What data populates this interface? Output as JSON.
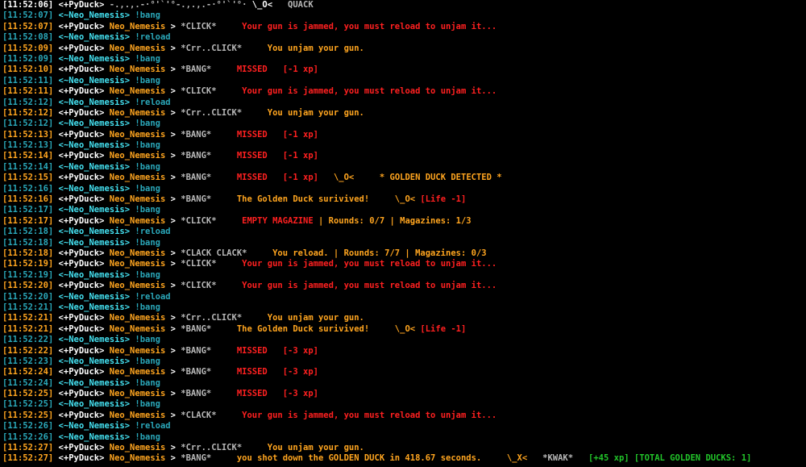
{
  "colors": {
    "background": "#000000",
    "gray": "#b8b8b8",
    "white": "#ffffff",
    "orange": "#ffa51f",
    "teal": "#2aa7b9",
    "cyan": "#44e0f0",
    "red": "#ff2020",
    "green": "#22c52a"
  },
  "lines": [
    {
      "kind": "message",
      "segments": [
        {
          "text": "[11:52:06] ",
          "color": "white"
        },
        {
          "text": "<+PyDuck> ",
          "color": "white"
        },
        {
          "text": "-.,.,.-·°'`'°-.,.,.-·°'`'°· ",
          "color": "gray"
        },
        {
          "text": "\\_O<",
          "color": "white"
        },
        {
          "text": "   QUACK",
          "color": "gray"
        }
      ]
    },
    {
      "kind": "message",
      "segments": [
        {
          "text": "[11:52:07] ",
          "color": "teal"
        },
        {
          "text": "<~Neo_Nemesis> ",
          "color": "cyan"
        },
        {
          "text": "!bang",
          "color": "teal"
        }
      ]
    },
    {
      "kind": "message",
      "segments": [
        {
          "text": "[11:52:07] ",
          "color": "orange"
        },
        {
          "text": "<+PyDuck> ",
          "color": "white"
        },
        {
          "text": "Neo_Nemesis",
          "color": "orange"
        },
        {
          "text": " > ",
          "color": "white"
        },
        {
          "text": "*CLICK*",
          "color": "gray"
        },
        {
          "text": "     Your gun is jammed, you must reload to unjam it...",
          "color": "red"
        }
      ]
    },
    {
      "kind": "message",
      "segments": [
        {
          "text": "[11:52:08] ",
          "color": "teal"
        },
        {
          "text": "<~Neo_Nemesis> ",
          "color": "cyan"
        },
        {
          "text": "!reload",
          "color": "teal"
        }
      ]
    },
    {
      "kind": "message",
      "segments": [
        {
          "text": "[11:52:09] ",
          "color": "orange"
        },
        {
          "text": "<+PyDuck> ",
          "color": "white"
        },
        {
          "text": "Neo_Nemesis",
          "color": "orange"
        },
        {
          "text": " > ",
          "color": "white"
        },
        {
          "text": "*Crr..CLICK*",
          "color": "gray"
        },
        {
          "text": "     You unjam your gun.",
          "color": "orange"
        }
      ]
    },
    {
      "kind": "message",
      "segments": [
        {
          "text": "[11:52:09] ",
          "color": "teal"
        },
        {
          "text": "<~Neo_Nemesis> ",
          "color": "cyan"
        },
        {
          "text": "!bang",
          "color": "teal"
        }
      ]
    },
    {
      "kind": "message",
      "segments": [
        {
          "text": "[11:52:10] ",
          "color": "orange"
        },
        {
          "text": "<+PyDuck> ",
          "color": "white"
        },
        {
          "text": "Neo_Nemesis",
          "color": "orange"
        },
        {
          "text": " > ",
          "color": "white"
        },
        {
          "text": "*BANG*",
          "color": "gray"
        },
        {
          "text": "     MISSED   [-1 xp]",
          "color": "red"
        }
      ]
    },
    {
      "kind": "message",
      "segments": [
        {
          "text": "[11:52:11] ",
          "color": "teal"
        },
        {
          "text": "<~Neo_Nemesis> ",
          "color": "cyan"
        },
        {
          "text": "!bang",
          "color": "teal"
        }
      ]
    },
    {
      "kind": "message",
      "segments": [
        {
          "text": "[11:52:11] ",
          "color": "orange"
        },
        {
          "text": "<+PyDuck> ",
          "color": "white"
        },
        {
          "text": "Neo_Nemesis",
          "color": "orange"
        },
        {
          "text": " > ",
          "color": "white"
        },
        {
          "text": "*CLICK*",
          "color": "gray"
        },
        {
          "text": "     Your gun is jammed, you must reload to unjam it...",
          "color": "red"
        }
      ]
    },
    {
      "kind": "message",
      "segments": [
        {
          "text": "[11:52:12] ",
          "color": "teal"
        },
        {
          "text": "<~Neo_Nemesis> ",
          "color": "cyan"
        },
        {
          "text": "!reload",
          "color": "teal"
        }
      ]
    },
    {
      "kind": "message",
      "segments": [
        {
          "text": "[11:52:12] ",
          "color": "orange"
        },
        {
          "text": "<+PyDuck> ",
          "color": "white"
        },
        {
          "text": "Neo_Nemesis",
          "color": "orange"
        },
        {
          "text": " > ",
          "color": "white"
        },
        {
          "text": "*Crr..CLICK*",
          "color": "gray"
        },
        {
          "text": "     You unjam your gun.",
          "color": "orange"
        }
      ]
    },
    {
      "kind": "message",
      "segments": [
        {
          "text": "[11:52:12] ",
          "color": "teal"
        },
        {
          "text": "<~Neo_Nemesis> ",
          "color": "cyan"
        },
        {
          "text": "!bang",
          "color": "teal"
        }
      ]
    },
    {
      "kind": "message",
      "segments": [
        {
          "text": "[11:52:13] ",
          "color": "orange"
        },
        {
          "text": "<+PyDuck> ",
          "color": "white"
        },
        {
          "text": "Neo_Nemesis",
          "color": "orange"
        },
        {
          "text": " > ",
          "color": "white"
        },
        {
          "text": "*BANG*",
          "color": "gray"
        },
        {
          "text": "     MISSED   [-1 xp]",
          "color": "red"
        }
      ]
    },
    {
      "kind": "message",
      "segments": [
        {
          "text": "[11:52:13] ",
          "color": "teal"
        },
        {
          "text": "<~Neo_Nemesis> ",
          "color": "cyan"
        },
        {
          "text": "!bang",
          "color": "teal"
        }
      ]
    },
    {
      "kind": "message",
      "segments": [
        {
          "text": "[11:52:14] ",
          "color": "orange"
        },
        {
          "text": "<+PyDuck> ",
          "color": "white"
        },
        {
          "text": "Neo_Nemesis",
          "color": "orange"
        },
        {
          "text": " > ",
          "color": "white"
        },
        {
          "text": "*BANG*",
          "color": "gray"
        },
        {
          "text": "     MISSED   [-1 xp]",
          "color": "red"
        }
      ]
    },
    {
      "kind": "message",
      "segments": [
        {
          "text": "[11:52:14] ",
          "color": "teal"
        },
        {
          "text": "<~Neo_Nemesis> ",
          "color": "cyan"
        },
        {
          "text": "!bang",
          "color": "teal"
        }
      ]
    },
    {
      "kind": "message",
      "segments": [
        {
          "text": "[11:52:15] ",
          "color": "orange"
        },
        {
          "text": "<+PyDuck> ",
          "color": "white"
        },
        {
          "text": "Neo_Nemesis",
          "color": "orange"
        },
        {
          "text": " > ",
          "color": "white"
        },
        {
          "text": "*BANG*",
          "color": "gray"
        },
        {
          "text": "     MISSED   [-1 xp]",
          "color": "red"
        },
        {
          "text": "   \\_O<",
          "color": "orange"
        },
        {
          "text": "     * GOLDEN DUCK DETECTED *",
          "color": "orange"
        }
      ]
    },
    {
      "kind": "message",
      "segments": [
        {
          "text": "[11:52:16] ",
          "color": "teal"
        },
        {
          "text": "<~Neo_Nemesis> ",
          "color": "cyan"
        },
        {
          "text": "!bang",
          "color": "teal"
        }
      ]
    },
    {
      "kind": "message",
      "segments": [
        {
          "text": "[11:52:16] ",
          "color": "orange"
        },
        {
          "text": "<+PyDuck> ",
          "color": "white"
        },
        {
          "text": "Neo_Nemesis",
          "color": "orange"
        },
        {
          "text": " > ",
          "color": "white"
        },
        {
          "text": "*BANG*",
          "color": "gray"
        },
        {
          "text": "     The Golden Duck surivived!",
          "color": "orange"
        },
        {
          "text": "     \\_O< ",
          "color": "orange"
        },
        {
          "text": "[Life -1]",
          "color": "red"
        }
      ]
    },
    {
      "kind": "message",
      "segments": [
        {
          "text": "[11:52:17] ",
          "color": "teal"
        },
        {
          "text": "<~Neo_Nemesis> ",
          "color": "cyan"
        },
        {
          "text": "!bang",
          "color": "teal"
        }
      ]
    },
    {
      "kind": "message",
      "segments": [
        {
          "text": "[11:52:17] ",
          "color": "orange"
        },
        {
          "text": "<+PyDuck> ",
          "color": "white"
        },
        {
          "text": "Neo_Nemesis",
          "color": "orange"
        },
        {
          "text": " > ",
          "color": "white"
        },
        {
          "text": "*CLICK*",
          "color": "gray"
        },
        {
          "text": "     EMPTY MAGAZINE",
          "color": "red"
        },
        {
          "text": " | Rounds: 0/7 | Magazines: 1/3",
          "color": "orange"
        }
      ]
    },
    {
      "kind": "message",
      "segments": [
        {
          "text": "[11:52:18] ",
          "color": "teal"
        },
        {
          "text": "<~Neo_Nemesis> ",
          "color": "cyan"
        },
        {
          "text": "!reload",
          "color": "teal"
        }
      ]
    },
    {
      "kind": "message",
      "segments": [
        {
          "text": "[11:52:18] ",
          "color": "teal"
        },
        {
          "text": "<~Neo_Nemesis> ",
          "color": "cyan"
        },
        {
          "text": "!bang",
          "color": "teal"
        }
      ]
    },
    {
      "kind": "message",
      "segments": [
        {
          "text": "[11:52:18] ",
          "color": "orange"
        },
        {
          "text": "<+PyDuck> ",
          "color": "white"
        },
        {
          "text": "Neo_Nemesis",
          "color": "orange"
        },
        {
          "text": " > ",
          "color": "white"
        },
        {
          "text": "*CLACK CLACK*",
          "color": "gray"
        },
        {
          "text": "     You reload. | Rounds: 7/7 | Magazines: 0/3",
          "color": "orange"
        }
      ]
    },
    {
      "kind": "message",
      "segments": [
        {
          "text": "[11:52:19] ",
          "color": "orange"
        },
        {
          "text": "<+PyDuck> ",
          "color": "white"
        },
        {
          "text": "Neo_Nemesis",
          "color": "orange"
        },
        {
          "text": " > ",
          "color": "white"
        },
        {
          "text": "*CLICK*",
          "color": "gray"
        },
        {
          "text": "     Your gun is jammed, you must reload to unjam it...",
          "color": "red"
        }
      ]
    },
    {
      "kind": "message",
      "segments": [
        {
          "text": "[11:52:19] ",
          "color": "teal"
        },
        {
          "text": "<~Neo_Nemesis> ",
          "color": "cyan"
        },
        {
          "text": "!bang",
          "color": "teal"
        }
      ]
    },
    {
      "kind": "message",
      "segments": [
        {
          "text": "[11:52:20] ",
          "color": "orange"
        },
        {
          "text": "<+PyDuck> ",
          "color": "white"
        },
        {
          "text": "Neo_Nemesis",
          "color": "orange"
        },
        {
          "text": " > ",
          "color": "white"
        },
        {
          "text": "*CLICK*",
          "color": "gray"
        },
        {
          "text": "     Your gun is jammed, you must reload to unjam it...",
          "color": "red"
        }
      ]
    },
    {
      "kind": "message",
      "segments": [
        {
          "text": "[11:52:20] ",
          "color": "teal"
        },
        {
          "text": "<~Neo_Nemesis> ",
          "color": "cyan"
        },
        {
          "text": "!reload",
          "color": "teal"
        }
      ]
    },
    {
      "kind": "message",
      "segments": [
        {
          "text": "[11:52:21] ",
          "color": "teal"
        },
        {
          "text": "<~Neo_Nemesis> ",
          "color": "cyan"
        },
        {
          "text": "!bang",
          "color": "teal"
        }
      ]
    },
    {
      "kind": "message",
      "segments": [
        {
          "text": "[11:52:21] ",
          "color": "orange"
        },
        {
          "text": "<+PyDuck> ",
          "color": "white"
        },
        {
          "text": "Neo_Nemesis",
          "color": "orange"
        },
        {
          "text": " > ",
          "color": "white"
        },
        {
          "text": "*Crr..CLICK*",
          "color": "gray"
        },
        {
          "text": "     You unjam your gun.",
          "color": "orange"
        }
      ]
    },
    {
      "kind": "message",
      "segments": [
        {
          "text": "[11:52:21] ",
          "color": "orange"
        },
        {
          "text": "<+PyDuck> ",
          "color": "white"
        },
        {
          "text": "Neo_Nemesis",
          "color": "orange"
        },
        {
          "text": " > ",
          "color": "white"
        },
        {
          "text": "*BANG*",
          "color": "gray"
        },
        {
          "text": "     The Golden Duck surivived!",
          "color": "orange"
        },
        {
          "text": "     \\_O< ",
          "color": "orange"
        },
        {
          "text": "[Life -1]",
          "color": "red"
        }
      ]
    },
    {
      "kind": "message",
      "segments": [
        {
          "text": "[11:52:22] ",
          "color": "teal"
        },
        {
          "text": "<~Neo_Nemesis> ",
          "color": "cyan"
        },
        {
          "text": "!bang",
          "color": "teal"
        }
      ]
    },
    {
      "kind": "message",
      "segments": [
        {
          "text": "[11:52:22] ",
          "color": "orange"
        },
        {
          "text": "<+PyDuck> ",
          "color": "white"
        },
        {
          "text": "Neo_Nemesis",
          "color": "orange"
        },
        {
          "text": " > ",
          "color": "white"
        },
        {
          "text": "*BANG*",
          "color": "gray"
        },
        {
          "text": "     MISSED   [-3 xp]",
          "color": "red"
        }
      ]
    },
    {
      "kind": "message",
      "segments": [
        {
          "text": "[11:52:23] ",
          "color": "teal"
        },
        {
          "text": "<~Neo_Nemesis> ",
          "color": "cyan"
        },
        {
          "text": "!bang",
          "color": "teal"
        }
      ]
    },
    {
      "kind": "message",
      "segments": [
        {
          "text": "[11:52:24] ",
          "color": "orange"
        },
        {
          "text": "<+PyDuck> ",
          "color": "white"
        },
        {
          "text": "Neo_Nemesis",
          "color": "orange"
        },
        {
          "text": " > ",
          "color": "white"
        },
        {
          "text": "*BANG*",
          "color": "gray"
        },
        {
          "text": "     MISSED   [-3 xp]",
          "color": "red"
        }
      ]
    },
    {
      "kind": "message",
      "segments": [
        {
          "text": "[11:52:24] ",
          "color": "teal"
        },
        {
          "text": "<~Neo_Nemesis> ",
          "color": "cyan"
        },
        {
          "text": "!bang",
          "color": "teal"
        }
      ]
    },
    {
      "kind": "message",
      "segments": [
        {
          "text": "[11:52:25] ",
          "color": "orange"
        },
        {
          "text": "<+PyDuck> ",
          "color": "white"
        },
        {
          "text": "Neo_Nemesis",
          "color": "orange"
        },
        {
          "text": " > ",
          "color": "white"
        },
        {
          "text": "*BANG*",
          "color": "gray"
        },
        {
          "text": "     MISSED   [-3 xp]",
          "color": "red"
        }
      ]
    },
    {
      "kind": "message",
      "segments": [
        {
          "text": "[11:52:25] ",
          "color": "teal"
        },
        {
          "text": "<~Neo_Nemesis> ",
          "color": "cyan"
        },
        {
          "text": "!bang",
          "color": "teal"
        }
      ]
    },
    {
      "kind": "message",
      "segments": [
        {
          "text": "[11:52:25] ",
          "color": "orange"
        },
        {
          "text": "<+PyDuck> ",
          "color": "white"
        },
        {
          "text": "Neo_Nemesis",
          "color": "orange"
        },
        {
          "text": " > ",
          "color": "white"
        },
        {
          "text": "*CLACK*",
          "color": "gray"
        },
        {
          "text": "     Your gun is jammed, you must reload to unjam it...",
          "color": "red"
        }
      ]
    },
    {
      "kind": "message",
      "segments": [
        {
          "text": "[11:52:26] ",
          "color": "teal"
        },
        {
          "text": "<~Neo_Nemesis> ",
          "color": "cyan"
        },
        {
          "text": "!reload",
          "color": "teal"
        }
      ]
    },
    {
      "kind": "message",
      "segments": [
        {
          "text": "[11:52:26] ",
          "color": "teal"
        },
        {
          "text": "<~Neo_Nemesis> ",
          "color": "cyan"
        },
        {
          "text": "!bang",
          "color": "teal"
        }
      ]
    },
    {
      "kind": "message",
      "segments": [
        {
          "text": "[11:52:27] ",
          "color": "orange"
        },
        {
          "text": "<+PyDuck> ",
          "color": "white"
        },
        {
          "text": "Neo_Nemesis",
          "color": "orange"
        },
        {
          "text": " > ",
          "color": "white"
        },
        {
          "text": "*Crr..CLICK*",
          "color": "gray"
        },
        {
          "text": "     You unjam your gun.",
          "color": "orange"
        }
      ]
    },
    {
      "kind": "message",
      "segments": [
        {
          "text": "[11:52:27] ",
          "color": "orange"
        },
        {
          "text": "<+PyDuck> ",
          "color": "white"
        },
        {
          "text": "Neo_Nemesis",
          "color": "orange"
        },
        {
          "text": " > ",
          "color": "white"
        },
        {
          "text": "*BANG*",
          "color": "gray"
        },
        {
          "text": "     you shot down the GOLDEN DUCK in 418.67 seconds.",
          "color": "orange"
        },
        {
          "text": "     \\_X<",
          "color": "orange"
        },
        {
          "text": "   *KWAK*",
          "color": "gray"
        },
        {
          "text": "   [+45 xp] [TOTAL GOLDEN DUCKS: 1]",
          "color": "green"
        }
      ]
    }
  ]
}
